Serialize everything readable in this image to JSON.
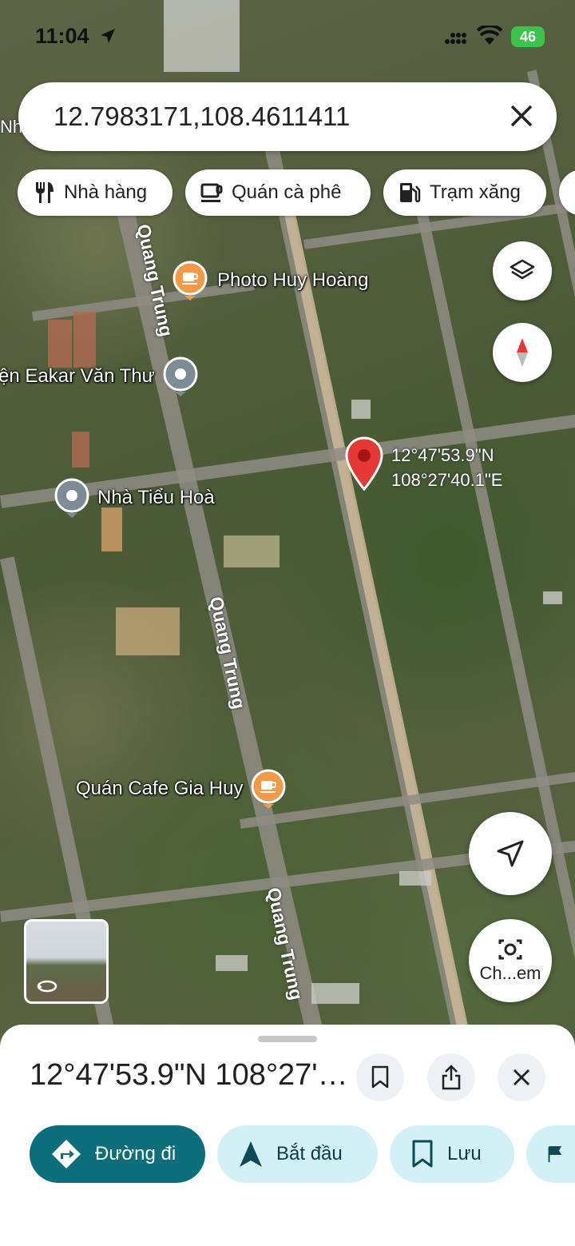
{
  "status": {
    "time": "11:04",
    "battery": "46"
  },
  "search": {
    "query": "12.7983171,108.4611411"
  },
  "chips": [
    {
      "label": "Nhà hàng",
      "icon": "fork-knife-icon"
    },
    {
      "label": "Quán cà phê",
      "icon": "coffee-cup-icon"
    },
    {
      "label": "Trạm xăng",
      "icon": "gas-pump-icon"
    }
  ],
  "map": {
    "pois": [
      {
        "label": "Photo Huy Hoàng",
        "icon": "orange-coffee-marker"
      },
      {
        "label": "ện Eakar Văn Thư",
        "icon": "gray-place-marker"
      },
      {
        "label": "Nhà Tiểu Hoà",
        "icon": "gray-place-marker"
      },
      {
        "label": "Quán Cafe Gia Huy",
        "icon": "orange-coffee-marker"
      }
    ],
    "edge_label": "Nh",
    "streets": [
      "Quang Trung",
      "Quang Trung",
      "Quang Trung"
    ],
    "pin": {
      "lat_text": "12°47'53.9\"N",
      "lng_text": "108°27'40.1\"E",
      "color": "#e53935"
    },
    "camera_button_label": "Ch...em"
  },
  "sheet": {
    "title": "12°47'53.9\"N 108°27'40.1\"E",
    "actions": [
      {
        "label": "Đường đi",
        "style": "primary",
        "color": "#0b6e7a"
      },
      {
        "label": "Bắt đầu",
        "style": "tonal",
        "color": "#d3f0f7"
      },
      {
        "label": "Lưu",
        "style": "tonal",
        "color": "#d3f0f7"
      }
    ]
  }
}
